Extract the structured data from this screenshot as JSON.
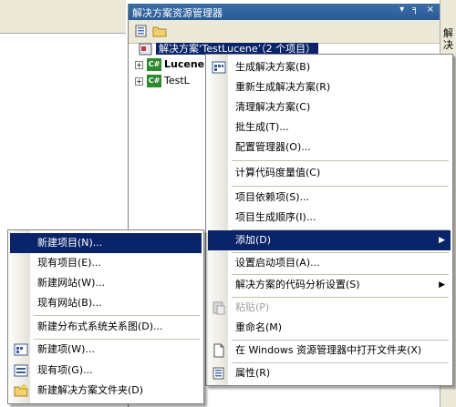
{
  "solution_explorer": {
    "title": "解决方案资源管理器",
    "title_buttons": "▾ ╕ ×",
    "root_label": "解决方案‘TestLucene’（2 个项目）",
    "projects": [
      {
        "label": "Lucene",
        "expander": "+"
      },
      {
        "label": "TestL",
        "expander": "+"
      }
    ]
  },
  "right_strip": {
    "label": "解决"
  },
  "context_menu": {
    "items": [
      {
        "label": "生成解决方案(B)",
        "icon": "build-icon"
      },
      {
        "label": "重新生成解决方案(R)"
      },
      {
        "label": "清理解决方案(C)"
      },
      {
        "label": "批生成(T)..."
      },
      {
        "label": "配置管理器(O)..."
      },
      {
        "label": "计算代码度量值(C)"
      },
      {
        "label": "项目依赖项(S)..."
      },
      {
        "label": "项目生成顺序(I)..."
      },
      {
        "label": "添加(D)",
        "arrow": "▶"
      },
      {
        "label": "设置启动项目(A)..."
      },
      {
        "label": "解决方案的代码分析设置(S)",
        "arrow": "▶"
      },
      {
        "label": "粘贴(P)",
        "icon": "paste-icon"
      },
      {
        "label": "重命名(M)"
      },
      {
        "label": "在 Windows 资源管理器中打开文件夹(X)",
        "icon": "open-folder-icon"
      },
      {
        "label": "属性(R)",
        "icon": "properties-icon"
      }
    ]
  },
  "add_submenu": {
    "items": [
      {
        "label": "新建项目(N)..."
      },
      {
        "label": "现有项目(E)..."
      },
      {
        "label": "新建网站(W)..."
      },
      {
        "label": "现有网站(B)..."
      },
      {
        "label": "新建分布式系统关系图(D)..."
      },
      {
        "label": "新建项(W)...",
        "icon": "new-item-icon"
      },
      {
        "label": "现有项(G)...",
        "icon": "existing-item-icon"
      },
      {
        "label": "新建解决方案文件夹(D)",
        "icon": "new-folder-icon"
      }
    ]
  },
  "colors": {
    "highlight": "#0a246a",
    "title_bar": "#3a6ea5"
  }
}
